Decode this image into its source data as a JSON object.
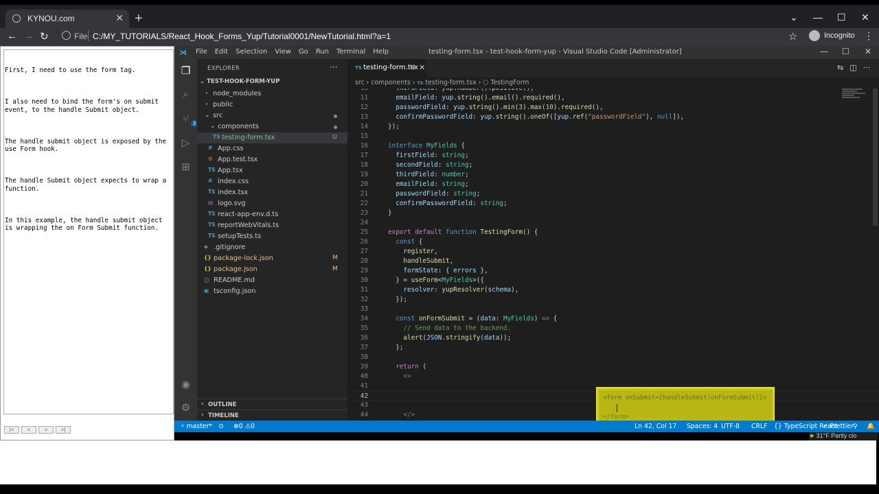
{
  "browser": {
    "tab_title": "KYNOU.com",
    "tab_close": "✕",
    "new_tab": "+",
    "url_label": "File",
    "url": "C:/MY_TUTORIALS/React_Hook_Forms_Yup/Tutorial0001/NewTutorial.html?a=1",
    "profile": "Incognito"
  },
  "notes": {
    "paragraphs": [
      "First, I need to use the form tag.",
      "I also need to bind the form's on submit event, to the handle Submit object.",
      "The handle submit object is exposed by the use Form hook.",
      "The handle Submit object expects to wrap a function.",
      "In this example, the handle submit object is wrapping the on Form Submit function."
    ],
    "controls": [
      "|<",
      "<",
      ">",
      ">|"
    ]
  },
  "vscode": {
    "menu": [
      "File",
      "Edit",
      "Selection",
      "View",
      "Go",
      "Run",
      "Terminal",
      "Help"
    ],
    "window_title": "testing-form.tsx - test-hook-form-yup - Visual Studio Code [Administrator]",
    "explorer_label": "EXPLORER",
    "project": "TEST-HOOK-FORM-YUP",
    "tree": [
      {
        "name": "node_modules",
        "type": "folder",
        "status": ""
      },
      {
        "name": "public",
        "type": "folder",
        "status": ""
      },
      {
        "name": "src",
        "type": "folder-open",
        "status": "dot"
      },
      {
        "name": "components",
        "type": "folder-open",
        "status": "dot"
      },
      {
        "name": "testing-form.tsx",
        "type": "ts",
        "status": "U"
      },
      {
        "name": "App.css",
        "type": "css",
        "status": ""
      },
      {
        "name": "App.test.tsx",
        "type": "test",
        "status": ""
      },
      {
        "name": "App.tsx",
        "type": "ts",
        "status": ""
      },
      {
        "name": "index.css",
        "type": "css",
        "status": ""
      },
      {
        "name": "index.tsx",
        "type": "ts",
        "status": ""
      },
      {
        "name": "logo.svg",
        "type": "svg",
        "status": ""
      },
      {
        "name": "react-app-env.d.ts",
        "type": "ts",
        "status": ""
      },
      {
        "name": "reportWebVitals.ts",
        "type": "ts",
        "status": ""
      },
      {
        "name": "setupTests.ts",
        "type": "ts",
        "status": ""
      },
      {
        "name": ".gitignore",
        "type": "git",
        "status": ""
      },
      {
        "name": "package-lock.json",
        "type": "json",
        "status": "M"
      },
      {
        "name": "package.json",
        "type": "json",
        "status": "M"
      },
      {
        "name": "README.md",
        "type": "md",
        "status": ""
      },
      {
        "name": "tsconfig.json",
        "type": "tsconfig",
        "status": ""
      }
    ],
    "outline_label": "OUTLINE",
    "timeline_label": "TIMELINE",
    "active_tab": {
      "name": "testing-form.tsx",
      "status": "U"
    },
    "breadcrumbs": {
      "a": "src",
      "b": "components",
      "c": "testing-form.tsx",
      "d": "TestingForm"
    },
    "highlight": {
      "line1": "<form onSubmit={handleSubmit(onFormSubmit)}>",
      "line3": "</form>"
    },
    "status": {
      "branch": "master*",
      "errors": "0",
      "warnings": "0",
      "position": "Ln 42, Col 17",
      "spaces": "Spaces: 4",
      "encoding": "UTF-8",
      "eol": "CRLF",
      "language": "TypeScript React",
      "formatter": "Prettier"
    },
    "weather": "31°F  Partly clo"
  }
}
